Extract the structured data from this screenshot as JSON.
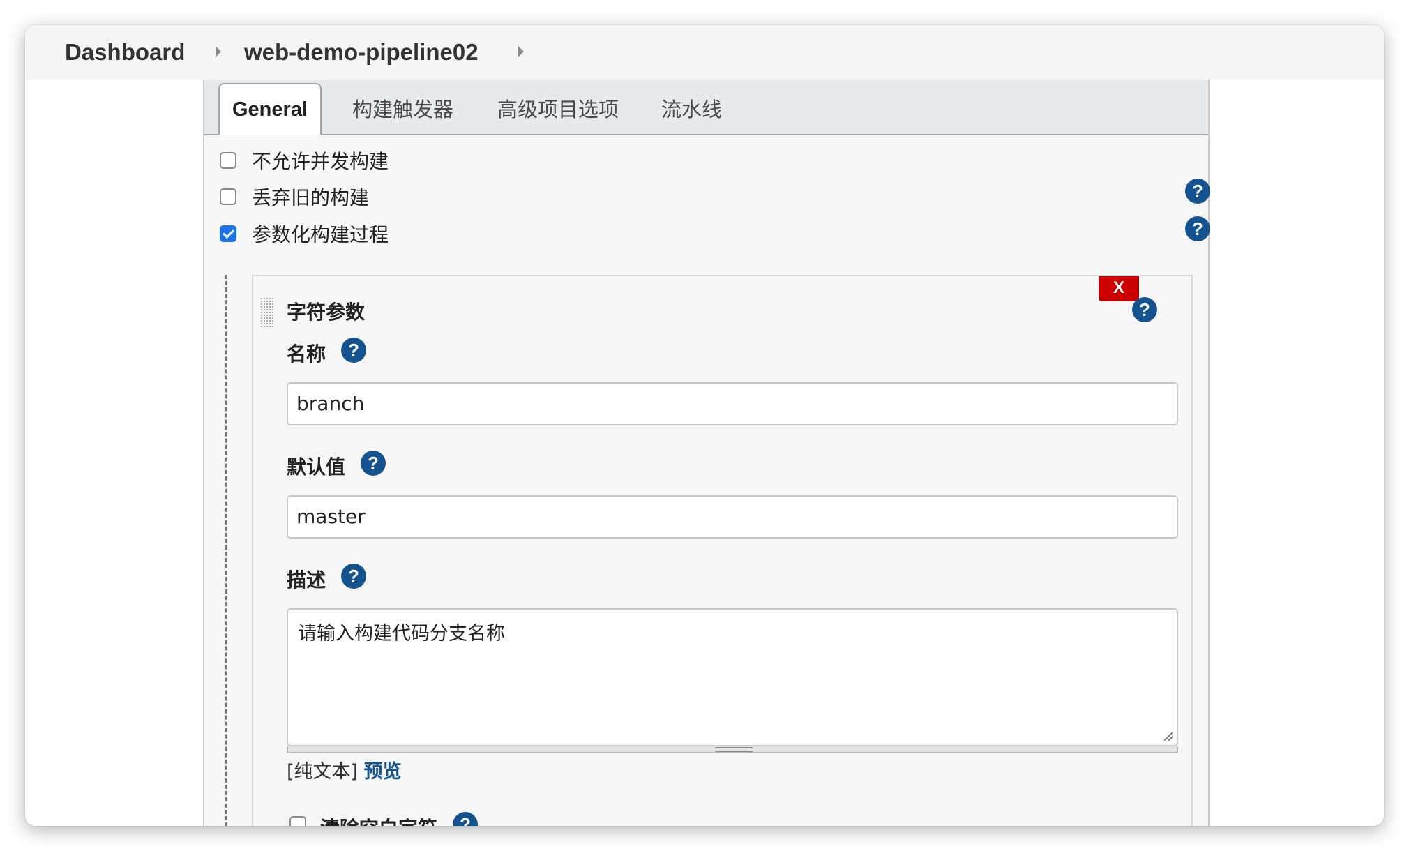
{
  "breadcrumb": {
    "items": [
      "Dashboard",
      "web-demo-pipeline02"
    ]
  },
  "tabs": [
    {
      "label": "General",
      "active": true
    },
    {
      "label": "构建触发器",
      "active": false
    },
    {
      "label": "高级项目选项",
      "active": false
    },
    {
      "label": "流水线",
      "active": false
    }
  ],
  "options": [
    {
      "label": "不允许并发构建",
      "checked": false
    },
    {
      "label": "丢弃旧的构建",
      "checked": false
    },
    {
      "label": "参数化构建过程",
      "checked": true
    }
  ],
  "parameter": {
    "type_title": "字符参数",
    "delete_label": "X",
    "name_label": "名称",
    "name_value": "branch",
    "default_label": "默认值",
    "default_value": "master",
    "description_label": "描述",
    "description_value": "请输入构建代码分支名称",
    "format_plain": "[纯文本]",
    "format_preview": "预览",
    "trim_label": "清除空白字符",
    "trim_checked": false
  },
  "help_symbol": "?",
  "colors": {
    "help_icon": "#14538f",
    "delete_button": "#cc0000",
    "checkbox_checked": "#1a73e8",
    "tabbar_bg": "#e6eaed"
  }
}
